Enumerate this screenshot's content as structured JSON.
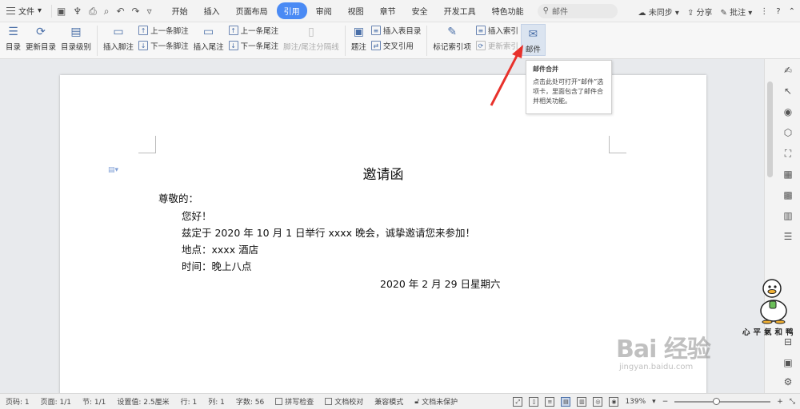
{
  "menubar": {
    "file_label": "文件",
    "tabs": [
      "开始",
      "插入",
      "页面布局",
      "引用",
      "审阅",
      "视图",
      "章节",
      "安全",
      "开发工具",
      "特色功能"
    ],
    "active_tab": "引用",
    "search_text": "邮件",
    "sync_label": "未同步",
    "share_label": "分享",
    "comment_label": "批注",
    "help_label": "?"
  },
  "ribbon": {
    "toc_label": "目录",
    "update_toc_label": "更新目录",
    "toc_level_label": "目录级别",
    "insert_footnote_label": "插入脚注",
    "prev_footnote_label": "上一条脚注",
    "next_footnote_label": "下一条脚注",
    "insert_endnote_label": "插入尾注",
    "prev_endnote_label": "上一条尾注",
    "next_endnote_label": "下一条尾注",
    "separator_label": "脚注/尾注分隔线",
    "caption_label": "题注",
    "insert_table_toc_label": "插入表目录",
    "cross_ref_label": "交叉引用",
    "mark_index_label": "标记索引项",
    "insert_index_label": "插入索引",
    "update_index_label": "更新索引",
    "mail_label": "邮件"
  },
  "tooltip": {
    "title": "邮件合并",
    "body": "点击此处可打开“邮件”选项卡，里面包含了邮件合并相关功能。"
  },
  "document": {
    "title": "邀请函",
    "lines": [
      "尊敬的：",
      "您好！",
      "兹定于 2020 年 10 月 1 日举行 xxxx 晚会，诚挚邀请您来参加！",
      "地点：xxxx 酒店",
      "时间：晚上八点",
      "2020 年 2 月 29 日星期六"
    ]
  },
  "watermark": {
    "main": "Bai 经验",
    "sub": "jingyan.baidu.com",
    "sticker_text": "心平氣和鸭"
  },
  "statusbar": {
    "page_code": "页码: 1",
    "page_count": "页面: 1/1",
    "section": "节: 1/1",
    "setting": "设置值: 2.5厘米",
    "row": "行: 1",
    "col": "列: 1",
    "word_count": "字数: 56",
    "spell_check": "拼写检查",
    "doc_check": "文档校对",
    "compat_mode": "兼容模式",
    "doc_protect": "文档未保护",
    "zoom": "139%"
  },
  "colors": {
    "accent": "#4a8af4",
    "arrow": "#e8312b"
  }
}
